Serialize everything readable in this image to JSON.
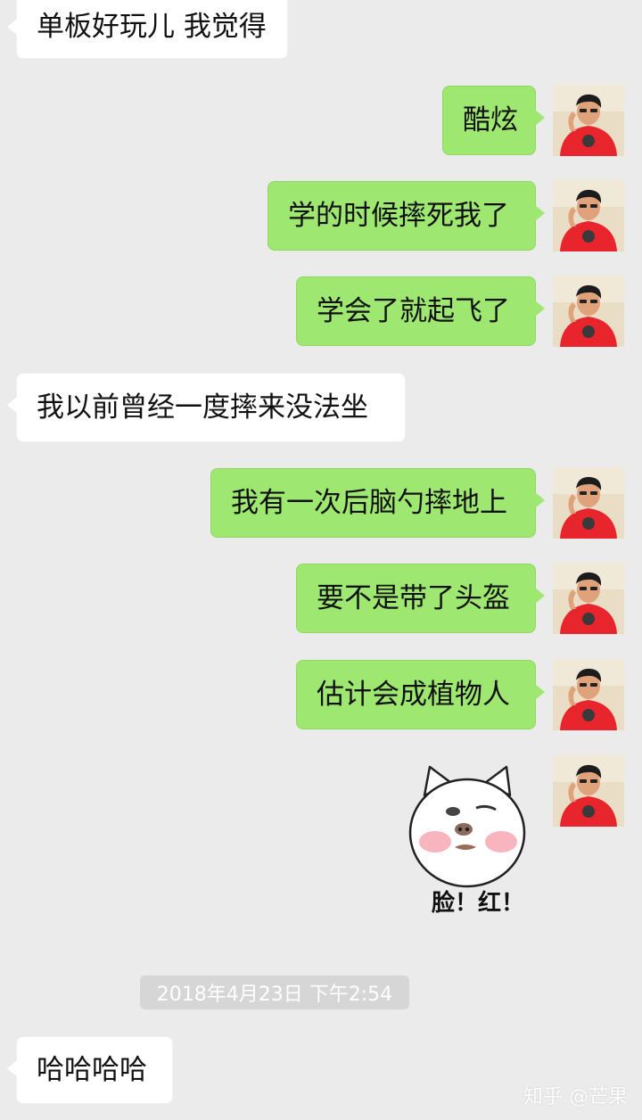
{
  "messages": [
    {
      "side": "in",
      "text": "单板好玩儿 我觉得"
    },
    {
      "side": "out",
      "text": "酷炫"
    },
    {
      "side": "out",
      "text": "学的时候摔死我了"
    },
    {
      "side": "out",
      "text": "学会了就起飞了"
    },
    {
      "side": "in",
      "text": "我以前曾经一度摔来没法坐"
    },
    {
      "side": "out",
      "text": "我有一次后脑勺摔地上"
    },
    {
      "side": "out",
      "text": "要不是带了头盔"
    },
    {
      "side": "out",
      "text": "估计会成植物人"
    },
    {
      "side": "in",
      "text": "哈哈哈哈"
    }
  ],
  "sticker": {
    "caption": "脸！红！"
  },
  "timestamp": "2018年4月23日 下午2:54",
  "watermark": "知乎 @芒果",
  "colors": {
    "background": "#ebebeb",
    "outgoing_bubble": "#9ee871",
    "incoming_bubble": "#ffffff"
  },
  "icons": {
    "avatar": "user-avatar-photo",
    "sticker": "blushing-pig-sticker"
  }
}
